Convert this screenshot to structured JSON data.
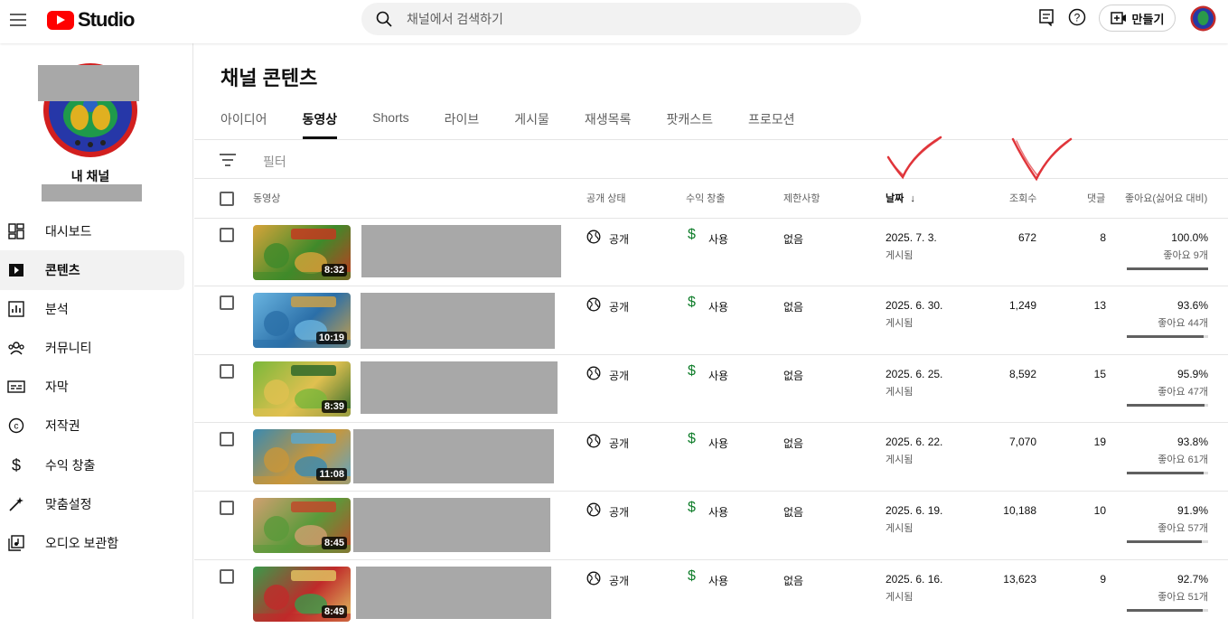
{
  "header": {
    "logo_text": "Studio",
    "search_placeholder": "채널에서 검색하기",
    "create_label": "만들기"
  },
  "sidebar": {
    "channel_label": "내 채널",
    "items": [
      {
        "label": "대시보드",
        "icon": "dashboard-icon"
      },
      {
        "label": "콘텐츠",
        "icon": "content-icon",
        "active": true
      },
      {
        "label": "분석",
        "icon": "analytics-icon"
      },
      {
        "label": "커뮤니티",
        "icon": "community-icon"
      },
      {
        "label": "자막",
        "icon": "subtitles-icon"
      },
      {
        "label": "저작권",
        "icon": "copyright-icon"
      },
      {
        "label": "수익 창출",
        "icon": "monetization-icon"
      },
      {
        "label": "맞춤설정",
        "icon": "customization-icon"
      },
      {
        "label": "오디오 보관함",
        "icon": "audio-library-icon"
      }
    ]
  },
  "main": {
    "title": "채널 콘텐츠",
    "tabs": [
      "아이디어",
      "동영상",
      "Shorts",
      "라이브",
      "게시물",
      "재생목록",
      "팟캐스트",
      "프로모션"
    ],
    "active_tab": "동영상",
    "filter_placeholder": "필터",
    "columns": {
      "video": "동영상",
      "visibility": "공개 상태",
      "monetization": "수익 창출",
      "restrictions": "제한사항",
      "date": "날짜",
      "views": "조회수",
      "comments": "댓글",
      "likes": "좋아요(싫어요 대비)"
    },
    "rows": [
      {
        "duration": "8:32",
        "visibility": "공개",
        "monetization": "사용",
        "restrictions": "없음",
        "date": "2025. 7. 3.",
        "date_status": "게시됨",
        "views": "672",
        "comments": "8",
        "like_pct": "100.0%",
        "like_count": "좋아요 9개",
        "like_ratio": 1.0
      },
      {
        "duration": "10:19",
        "visibility": "공개",
        "monetization": "사용",
        "restrictions": "없음",
        "date": "2025. 6. 30.",
        "date_status": "게시됨",
        "views": "1,249",
        "comments": "13",
        "like_pct": "93.6%",
        "like_count": "좋아요 44개",
        "like_ratio": 0.936
      },
      {
        "duration": "8:39",
        "visibility": "공개",
        "monetization": "사용",
        "restrictions": "없음",
        "date": "2025. 6. 25.",
        "date_status": "게시됨",
        "views": "8,592",
        "comments": "15",
        "like_pct": "95.9%",
        "like_count": "좋아요 47개",
        "like_ratio": 0.959
      },
      {
        "duration": "11:08",
        "visibility": "공개",
        "monetization": "사용",
        "restrictions": "없음",
        "date": "2025. 6. 22.",
        "date_status": "게시됨",
        "views": "7,070",
        "comments": "19",
        "like_pct": "93.8%",
        "like_count": "좋아요 61개",
        "like_ratio": 0.938
      },
      {
        "duration": "8:45",
        "visibility": "공개",
        "monetization": "사용",
        "restrictions": "없음",
        "date": "2025. 6. 19.",
        "date_status": "게시됨",
        "views": "10,188",
        "comments": "10",
        "like_pct": "91.9%",
        "like_count": "좋아요 57개",
        "like_ratio": 0.919
      },
      {
        "duration": "8:49",
        "visibility": "공개",
        "monetization": "사용",
        "restrictions": "없음",
        "date": "2025. 6. 16.",
        "date_status": "게시됨",
        "views": "13,623",
        "comments": "9",
        "like_pct": "92.7%",
        "like_count": "좋아요 51개",
        "like_ratio": 0.927
      }
    ]
  },
  "colors": {
    "brand_red": "#ff0000",
    "monetization_green": "#0f7d2a",
    "annotation_red": "#e0353a"
  }
}
